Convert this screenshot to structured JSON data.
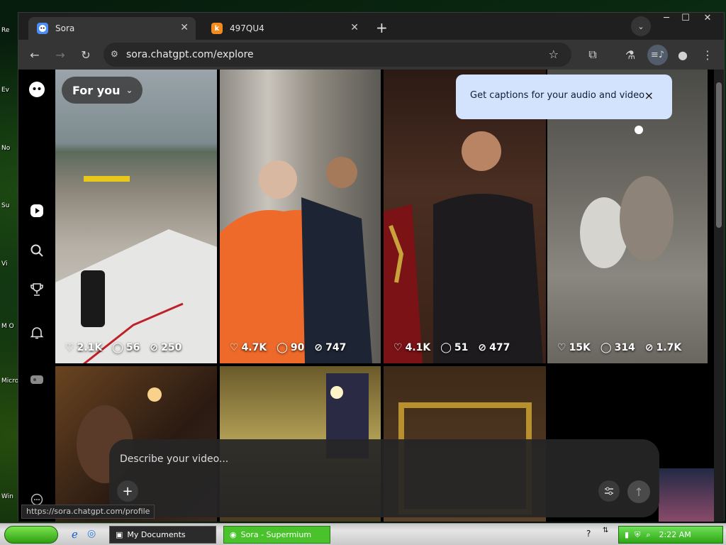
{
  "desktop": {
    "icons": [
      "Re",
      "Ev",
      "No",
      "Su",
      "Vi",
      "M O",
      "Micro Stu",
      "Win"
    ]
  },
  "browser": {
    "tabs": [
      {
        "title": "Sora",
        "active": true
      },
      {
        "title": "497QU4",
        "favicon_letter": "k",
        "active": false
      }
    ],
    "url": "sora.chatgpt.com/explore",
    "status_url": "https://sora.chatgpt.com/profile",
    "window_controls": {
      "minimize": "─",
      "restore": "☐",
      "close": "✕"
    }
  },
  "sora": {
    "feed_selector": "For you",
    "tooltip": {
      "text": "Get captions for your audio and video",
      "close": "×"
    },
    "cards": [
      {
        "likes": "2.1K",
        "comments": "56",
        "remixes": "250"
      },
      {
        "likes": "4.7K",
        "comments": "90",
        "remixes": "747"
      },
      {
        "likes": "4.1K",
        "comments": "51",
        "remixes": "477"
      },
      {
        "likes": "15K",
        "comments": "314",
        "remixes": "1.7K"
      }
    ],
    "composer": {
      "placeholder": "Describe your video...",
      "add": "+"
    }
  },
  "taskbar": {
    "tasks": [
      {
        "label": "My Documents"
      },
      {
        "label": "Sora - Supermium"
      }
    ],
    "clock": "2:22 AM"
  },
  "colors": {
    "tooltip_bg": "#d3e3fd",
    "tab_active": "#353535",
    "taskbar_active": "#49c22c"
  }
}
